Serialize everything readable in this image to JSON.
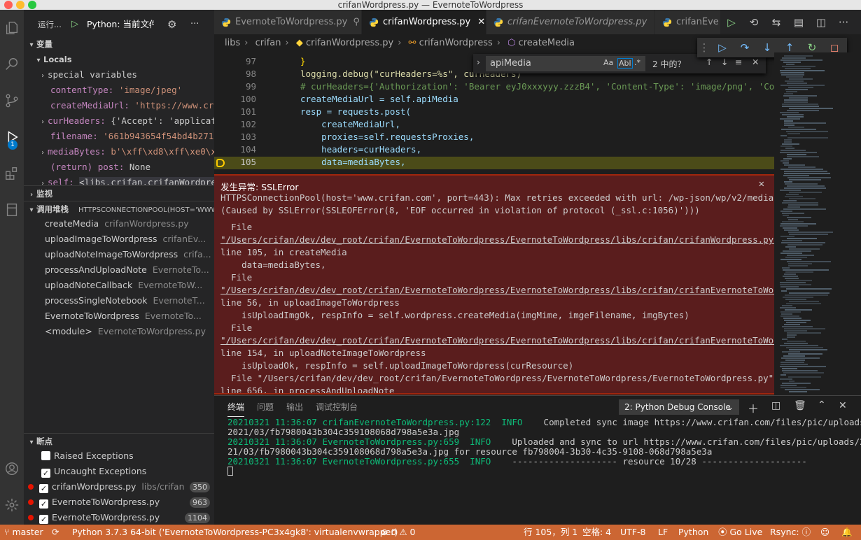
{
  "window": {
    "title": "crifanWordpress.py — EvernoteToWordpress"
  },
  "debug_header": {
    "run_label": "运行...",
    "config_name": "Python: 当前文件"
  },
  "variables": {
    "section_label": "变量",
    "locals_label": "Locals",
    "items": [
      {
        "name": "special variables",
        "value": ""
      },
      {
        "name": "contentType:",
        "value": "'image/jpeg'"
      },
      {
        "name": "createMediaUrl:",
        "value": "'https://www.crifa..."
      },
      {
        "name": "curHeaders:",
        "value": "{'Accept': 'applicatio..."
      },
      {
        "name": "filename:",
        "value": "'661b943654f54bd4b271126..."
      },
      {
        "name": "mediaBytes:",
        "value": "b'\\xff\\xd8\\xff\\xe0\\x00..."
      },
      {
        "name": "(return) post:",
        "value": "None"
      },
      {
        "name": "self:",
        "value": "<libs.crifan.crifanWordpress..."
      }
    ]
  },
  "watch": {
    "section_label": "监视"
  },
  "callstack": {
    "section_label": "调用堆栈",
    "thread_label": "HTTPSCONNECTIONPOOL(HOST='WWW.CR",
    "frames": [
      {
        "name": "createMedia",
        "file": "crifanWordpress.py"
      },
      {
        "name": "uploadImageToWordpress",
        "file": "crifanEv..."
      },
      {
        "name": "uploadNoteImageToWordpress",
        "file": "crifa..."
      },
      {
        "name": "processAndUploadNote",
        "file": "EvernoteTo..."
      },
      {
        "name": "uploadNoteCallback",
        "file": "EvernoteToW..."
      },
      {
        "name": "processSingleNotebook",
        "file": "EvernoteT..."
      },
      {
        "name": "EvernoteToWordpress",
        "file": "EvernoteTo..."
      },
      {
        "name": "<module>",
        "file": "EvernoteToWordpress.py"
      }
    ]
  },
  "breakpoints": {
    "section_label": "断点",
    "exceptions": [
      {
        "label": "Raised Exceptions",
        "checked": false
      },
      {
        "label": "Uncaught Exceptions",
        "checked": true
      }
    ],
    "items": [
      {
        "file": "crifanWordpress.py",
        "path": "libs/crifan",
        "line": "350"
      },
      {
        "file": "EvernoteToWordpress.py",
        "path": "",
        "line": "963"
      },
      {
        "file": "EvernoteToWordpress.py",
        "path": "",
        "line": "1104"
      }
    ]
  },
  "activity": {
    "debug_badge": "1"
  },
  "tabs": [
    {
      "label": "EvernoteToWordpress.py",
      "active": false
    },
    {
      "label": "crifanWordpress.py",
      "active": true
    },
    {
      "label": "crifanEvernoteToWordpress.py",
      "active": false
    },
    {
      "label": "crifanEve",
      "active": false
    }
  ],
  "breadcrumb": [
    "libs",
    "crifan",
    "crifanWordpress.py",
    "crifanWordpress",
    "createMedia"
  ],
  "find": {
    "query": "apiMedia",
    "match_case": "Aa",
    "whole_word": "Abl",
    "regex": ".*",
    "result": "2 中的？"
  },
  "editor": {
    "lines": [
      {
        "num": "97",
        "text": "}"
      },
      {
        "num": "98",
        "text": "logging.debug(\"curHeaders=%s\", curHeaders)"
      },
      {
        "num": "99",
        "text": "# curHeaders={'Authorization': 'Bearer eyJ0xxxyyy.zzzB4', 'Content-Type': 'image/png', 'Conten"
      },
      {
        "num": "100",
        "text": "createMediaUrl = self.apiMedia"
      },
      {
        "num": "101",
        "text": "resp = requests.post("
      },
      {
        "num": "102",
        "text": "    createMediaUrl,"
      },
      {
        "num": "103",
        "text": "    proxies=self.requestsProxies,"
      },
      {
        "num": "104",
        "text": "    headers=curHeaders,"
      },
      {
        "num": "105",
        "text": "    data=mediaBytes,"
      }
    ]
  },
  "exception": {
    "title": "发生异常: SSLError",
    "lines": [
      "HTTPSConnectionPool(host='www.crifan.com', port=443): Max retries exceeded with url: /wp-json/wp/v2/media",
      "(Caused by SSLError(SSLEOFError(8, 'EOF occurred in violation of protocol (_ssl.c:1056)')))",
      "  File",
      "\"/Users/crifan/dev/dev_root/crifan/EvernoteToWordpress/EvernoteToWordpress/libs/crifan/crifanWordpress.py\",",
      "line 105, in createMedia",
      "    data=mediaBytes,",
      "  File",
      "\"/Users/crifan/dev/dev_root/crifan/EvernoteToWordpress/EvernoteToWordpress/libs/crifan/crifanEvernoteToWordpre",
      "line 56, in uploadImageToWordpress",
      "    isUploadImgOk, respInfo = self.wordpress.createMedia(imgMime, imgeFilename, imgBytes)",
      "  File",
      "\"/Users/crifan/dev/dev_root/crifan/EvernoteToWordpress/EvernoteToWordpress/libs/crifan/crifanEvernoteToWordpre",
      "line 154, in uploadNoteImageToWordpress",
      "    isUploadOk, respInfo = self.uploadImageToWordpress(curResource)",
      "  File \"/Users/crifan/dev/dev_root/crifan/EvernoteToWordpress/EvernoteToWordpress/EvernoteToWordpress.py\",",
      "line 656, in processAndUploadNote"
    ]
  },
  "panel": {
    "tabs": [
      "终端",
      "问题",
      "输出",
      "调试控制台"
    ],
    "terminal_select": "2: Python Debug Console",
    "lines": [
      {
        "prefix": "20210321 11:36:07 crifanEvernoteToWordpress.py:122  INFO",
        "rest": "    Completed sync image https://www.crifan.com/files/pic/uploads/"
      },
      {
        "prefix": "",
        "rest": "2021/03/fb7980043b304c359108068d798a5e3a.jpg"
      },
      {
        "prefix": "20210321 11:36:07 EvernoteToWordpress.py:659  INFO",
        "rest": "    Uploaded and sync to url https://www.crifan.com/files/pic/uploads/20"
      },
      {
        "prefix": "",
        "rest": "21/03/fb7980043b304c359108068d798a5e3a.jpg for resource fb798004-3b30-4c35-9108-068d798a5e3a"
      },
      {
        "prefix": "20210321 11:36:07 EvernoteToWordpress.py:655  INFO",
        "rest": "    -------------------- resource 10/28 --------------------"
      }
    ]
  },
  "statusbar": {
    "branch": "master",
    "interpreter": "Python 3.7.3 64-bit ('EvernoteToWordpress-PC3x4gk8': virtualenvwrapper)",
    "problems": "⊗ 0 ⚠ 0",
    "position": "行 105，列 1",
    "spaces": "空格: 4",
    "encoding": "UTF-8",
    "eol": "LF",
    "language": "Python",
    "golive": "Go Live",
    "rsync": "Rsync:"
  },
  "colors": {
    "accent": "#cc6633",
    "exception_bg": "#5a1d1d",
    "current_line": "#4b4b18"
  }
}
